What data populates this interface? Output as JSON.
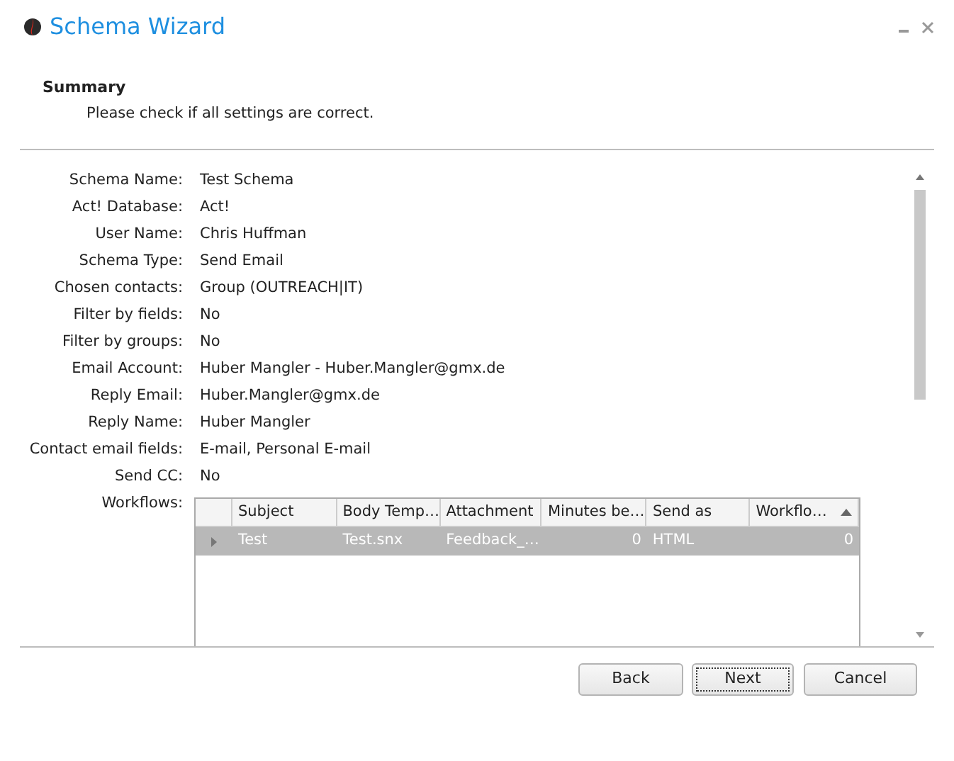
{
  "window": {
    "title": "Schema Wizard"
  },
  "header": {
    "title": "Summary",
    "subtitle": "Please check if all settings are correct."
  },
  "fields": [
    {
      "label": "Schema Name:",
      "value": "Test Schema"
    },
    {
      "label": "Act! Database:",
      "value": "Act!"
    },
    {
      "label": "User Name:",
      "value": "Chris Huffman"
    },
    {
      "label": "Schema Type:",
      "value": "Send Email"
    },
    {
      "label": "Chosen contacts:",
      "value": "Group (OUTREACH|IT)"
    },
    {
      "label": "Filter by fields:",
      "value": "No"
    },
    {
      "label": "Filter by groups:",
      "value": "No"
    },
    {
      "label": "Email Account:",
      "value": "Huber Mangler - Huber.Mangler@gmx.de"
    },
    {
      "label": "Reply Email:",
      "value": "Huber.Mangler@gmx.de"
    },
    {
      "label": "Reply Name:",
      "value": "Huber Mangler"
    },
    {
      "label": "Contact email fields:",
      "value": "E-mail, Personal E-mail"
    },
    {
      "label": "Send CC:",
      "value": "No"
    }
  ],
  "workflows": {
    "label": "Workflows:",
    "columns": [
      {
        "title": "Subject",
        "kind": "text"
      },
      {
        "title": "Body Temp…",
        "kind": "text"
      },
      {
        "title": "Attachment",
        "kind": "text"
      },
      {
        "title": "Minutes be…",
        "kind": "number"
      },
      {
        "title": "Send as",
        "kind": "text"
      },
      {
        "title": "Workflo…",
        "kind": "number",
        "sorted": true
      }
    ],
    "rows": [
      {
        "selected": true,
        "cells": [
          "Test",
          "Test.snx",
          "Feedback_…",
          "0",
          "HTML",
          "0"
        ]
      }
    ]
  },
  "buttons": [
    {
      "label": "Back",
      "focused": false
    },
    {
      "label": "Next",
      "focused": true
    },
    {
      "label": "Cancel",
      "focused": false
    }
  ]
}
